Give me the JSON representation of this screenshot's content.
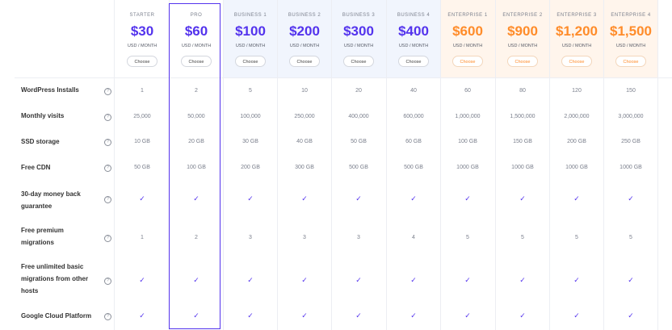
{
  "plans": [
    {
      "name": "STARTER",
      "price": "$30",
      "period": "USD / MONTH",
      "choose": "Choose",
      "tier": "starter"
    },
    {
      "name": "PRO",
      "price": "$60",
      "period": "USD / MONTH",
      "choose": "Choose",
      "tier": "pro"
    },
    {
      "name": "BUSINESS 1",
      "price": "$100",
      "period": "USD / MONTH",
      "choose": "Choose",
      "tier": "business"
    },
    {
      "name": "BUSINESS 2",
      "price": "$200",
      "period": "USD / MONTH",
      "choose": "Choose",
      "tier": "business"
    },
    {
      "name": "BUSINESS 3",
      "price": "$300",
      "period": "USD / MONTH",
      "choose": "Choose",
      "tier": "business"
    },
    {
      "name": "BUSINESS 4",
      "price": "$400",
      "period": "USD / MONTH",
      "choose": "Choose",
      "tier": "business"
    },
    {
      "name": "ENTERPRISE 1",
      "price": "$600",
      "period": "USD / MONTH",
      "choose": "Choose",
      "tier": "enterprise"
    },
    {
      "name": "ENTERPRISE 2",
      "price": "$900",
      "period": "USD / MONTH",
      "choose": "Choose",
      "tier": "enterprise"
    },
    {
      "name": "ENTERPRISE 3",
      "price": "$1,200",
      "period": "USD / MONTH",
      "choose": "Choose",
      "tier": "enterprise"
    },
    {
      "name": "ENTERPRISE 4",
      "price": "$1,500",
      "period": "USD / MONTH",
      "choose": "Choose",
      "tier": "enterprise"
    }
  ],
  "rows": [
    {
      "label": "WordPress Installs",
      "values": [
        "1",
        "2",
        "5",
        "10",
        "20",
        "40",
        "60",
        "80",
        "120",
        "150"
      ]
    },
    {
      "label": "Monthly visits",
      "values": [
        "25,000",
        "50,000",
        "100,000",
        "250,000",
        "400,000",
        "600,000",
        "1,000,000",
        "1,500,000",
        "2,000,000",
        "3,000,000"
      ]
    },
    {
      "label": "SSD storage",
      "values": [
        "10 GB",
        "20 GB",
        "30 GB",
        "40 GB",
        "50 GB",
        "60 GB",
        "100 GB",
        "150 GB",
        "200 GB",
        "250 GB"
      ]
    },
    {
      "label": "Free CDN",
      "values": [
        "50 GB",
        "100 GB",
        "200 GB",
        "300 GB",
        "500 GB",
        "500 GB",
        "1000 GB",
        "1000 GB",
        "1000 GB",
        "1000 GB"
      ]
    },
    {
      "label": "30-day money back guarantee",
      "values": [
        "✓",
        "✓",
        "✓",
        "✓",
        "✓",
        "✓",
        "✓",
        "✓",
        "✓",
        "✓"
      ]
    },
    {
      "label": "Free premium migrations",
      "values": [
        "1",
        "2",
        "3",
        "3",
        "3",
        "4",
        "5",
        "5",
        "5",
        "5"
      ]
    },
    {
      "label": "Free unlimited basic migrations from other hosts",
      "values": [
        "✓",
        "✓",
        "✓",
        "✓",
        "✓",
        "✓",
        "✓",
        "✓",
        "✓",
        "✓"
      ]
    },
    {
      "label": "Google Cloud Platform",
      "values": [
        "✓",
        "✓",
        "✓",
        "✓",
        "✓",
        "✓",
        "✓",
        "✓",
        "✓",
        "✓"
      ]
    }
  ],
  "info_glyph": "?",
  "icons": {
    "info": "info-circle-icon",
    "check": "check-icon"
  },
  "colors": {
    "accent": "#5333ed",
    "enterprise": "#ff8c2a",
    "business_bg": "#f1f5fd",
    "enterprise_bg": "#fff5ec"
  }
}
